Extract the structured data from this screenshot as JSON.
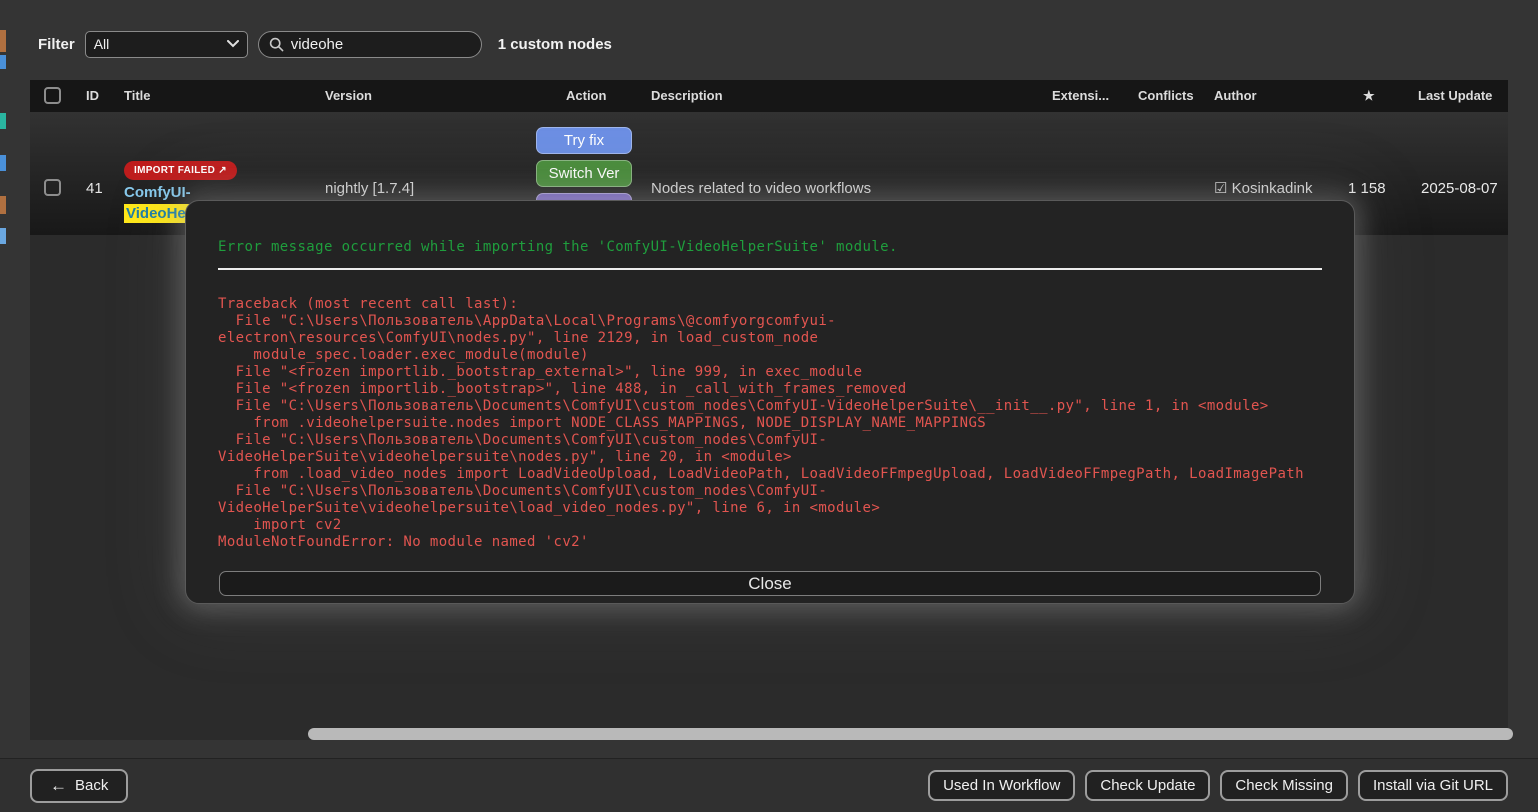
{
  "colors": {
    "page_bg": "#343434",
    "table_body_bg": "#2b2b2b",
    "header_bg": "#161616",
    "modal_bg": "#232323",
    "badge_red": "#bf1d1d",
    "btn_tryfix": "#6c8fe4",
    "btn_switchver": "#4a8d3c",
    "btn_hidden_purple": "#7a68c0",
    "title_blue": "#87c9ec",
    "highlight_yellow": "#ffe81a",
    "highlight_text": "#1f7fa6",
    "error_green": "#1f9e3d",
    "traceback_red": "#e25550",
    "scrollbar_thumb": "#b9b9b9"
  },
  "topbar": {
    "filter_label": "Filter",
    "filter_value": "All",
    "search_value": "videohe",
    "count_text": "1 custom nodes"
  },
  "table": {
    "headers": [
      "ID",
      "Title",
      "Version",
      "Action",
      "Description",
      "Extensi...",
      "Conflicts",
      "Author",
      "★",
      "Last Update"
    ],
    "row": {
      "id": "41",
      "badge": "IMPORT FAILED ↗",
      "title_line1": "ComfyUI-",
      "title_line2_highlight": "VideoHel",
      "version": "nightly [1.7.4]",
      "action_tryfix": "Try fix",
      "action_switchver": "Switch Ver",
      "description": "Nodes related to video workflows",
      "author_check": "☑",
      "author": "Kosinkadink",
      "stars": "1 158",
      "last_update": "2025-08-07"
    }
  },
  "modal": {
    "error_message": "Error message occurred while importing the 'ComfyUI-VideoHelperSuite' module.",
    "traceback": "Traceback (most recent call last):\n  File \"C:\\Users\\Пользователь\\AppData\\Local\\Programs\\@comfyorgcomfyui-\nelectron\\resources\\ComfyUI\\nodes.py\", line 2129, in load_custom_node\n    module_spec.loader.exec_module(module)\n  File \"<frozen importlib._bootstrap_external>\", line 999, in exec_module\n  File \"<frozen importlib._bootstrap>\", line 488, in _call_with_frames_removed\n  File \"C:\\Users\\Пользователь\\Documents\\ComfyUI\\custom_nodes\\ComfyUI-VideoHelperSuite\\__init__.py\", line 1, in <module>\n    from .videohelpersuite.nodes import NODE_CLASS_MAPPINGS, NODE_DISPLAY_NAME_MAPPINGS\n  File \"C:\\Users\\Пользователь\\Documents\\ComfyUI\\custom_nodes\\ComfyUI-\nVideoHelperSuite\\videohelpersuite\\nodes.py\", line 20, in <module>\n    from .load_video_nodes import LoadVideoUpload, LoadVideoPath, LoadVideoFFmpegUpload, LoadVideoFFmpegPath, LoadImagePath\n  File \"C:\\Users\\Пользователь\\Documents\\ComfyUI\\custom_nodes\\ComfyUI-\nVideoHelperSuite\\videohelpersuite\\load_video_nodes.py\", line 6, in <module>\n    import cv2\nModuleNotFoundError: No module named 'cv2'",
    "close_label": "Close"
  },
  "bottombar": {
    "back_icon": "←",
    "back_label": "Back",
    "buttons": [
      "Used In Workflow",
      "Check Update",
      "Check Missing",
      "Install via Git URL"
    ]
  }
}
